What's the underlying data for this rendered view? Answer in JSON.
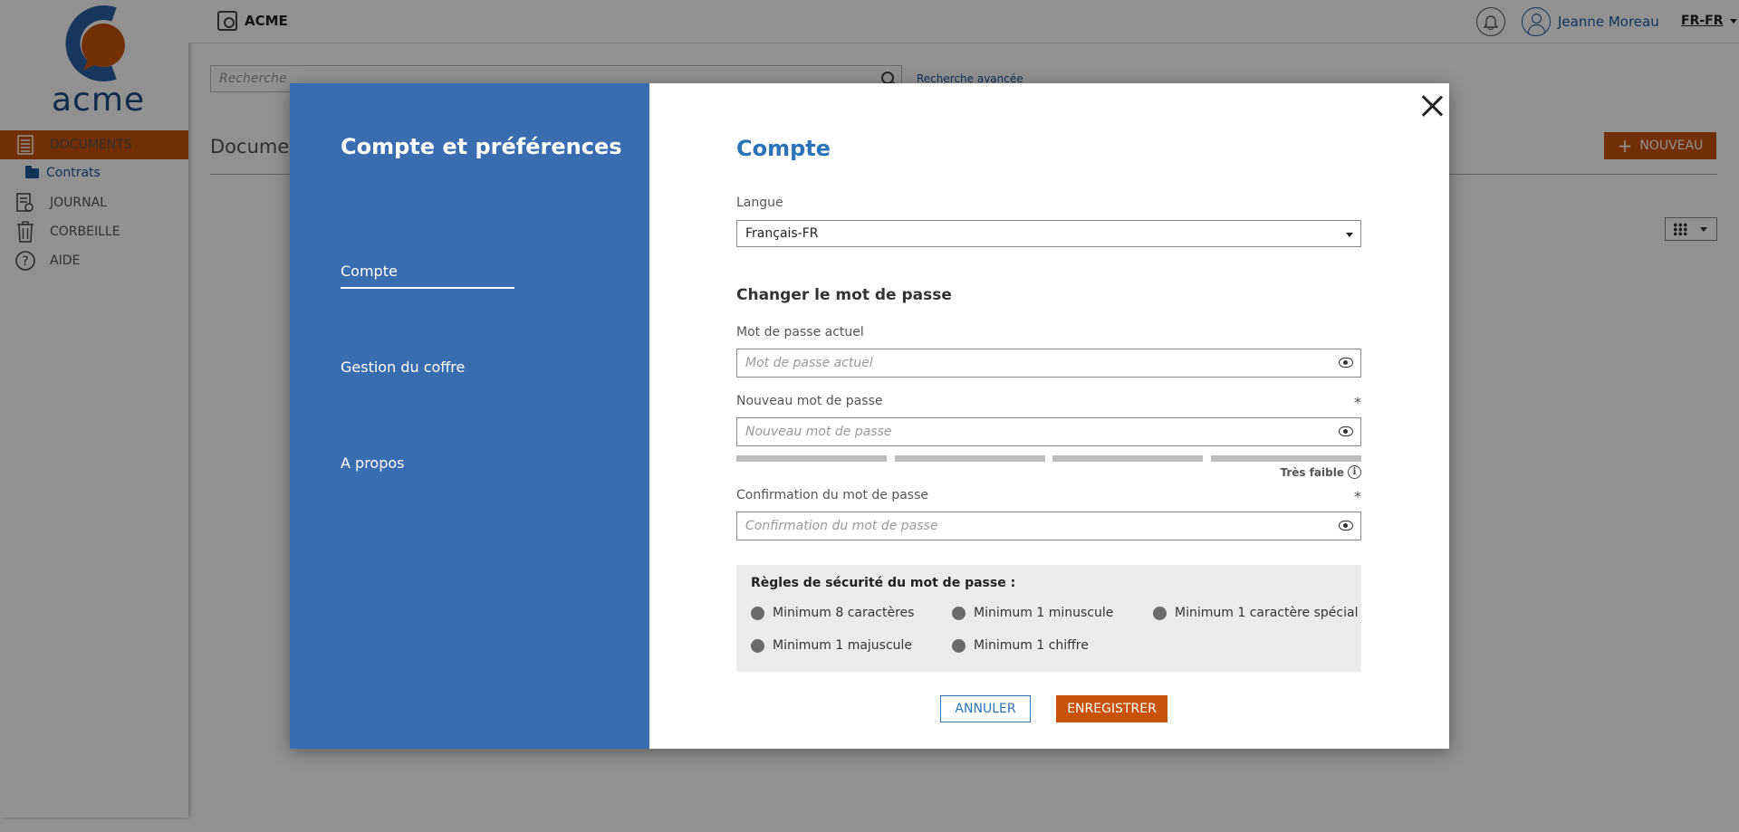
{
  "app": {
    "logo_text": "acme",
    "brand": "ACME",
    "user_name": "Jeanne Moreau",
    "language_code": "FR-FR",
    "accent_color": "#c8520a",
    "primary_color": "#3a6daf"
  },
  "sidebar": {
    "items": [
      {
        "label": "DOCUMENTS",
        "icon": "document-list-icon",
        "active": true
      },
      {
        "label": "JOURNAL",
        "icon": "journal-icon"
      },
      {
        "label": "CORBEILLE",
        "icon": "trash-icon"
      },
      {
        "label": "AIDE",
        "icon": "help-icon"
      }
    ],
    "sub_item": {
      "label": "Contrats",
      "icon": "folder-icon"
    }
  },
  "main": {
    "search_placeholder": "Recherche",
    "advanced_search": "Recherche avancée",
    "page_title": "Documents",
    "new_button": "NOUVEAU"
  },
  "modal": {
    "title": "Compte et préférences",
    "nav": [
      {
        "label": "Compte",
        "active": true
      },
      {
        "label": "Gestion du coffre"
      },
      {
        "label": "A propos"
      }
    ],
    "section_title": "Compte",
    "language_label": "Langue",
    "language_value": "Français-FR",
    "password_title": "Changer le mot de passe",
    "current_label": "Mot de passe actuel",
    "current_placeholder": "Mot de passe actuel",
    "new_label": "Nouveau mot de passe",
    "new_placeholder": "Nouveau mot de passe",
    "required_mark": "*",
    "strength_text": "Très faible",
    "confirm_label": "Confirmation du mot de passe",
    "confirm_placeholder": "Confirmation du mot de passe",
    "rules_title": "Règles de sécurité du mot de passe :",
    "rules": [
      "Minimum 8 caractères",
      "Minimum 1 minuscule",
      "Minimum 1 caractère spécial",
      "Minimum 1 majuscule",
      "Minimum 1 chiffre"
    ],
    "cancel": "ANNULER",
    "save": "ENREGISTRER"
  }
}
